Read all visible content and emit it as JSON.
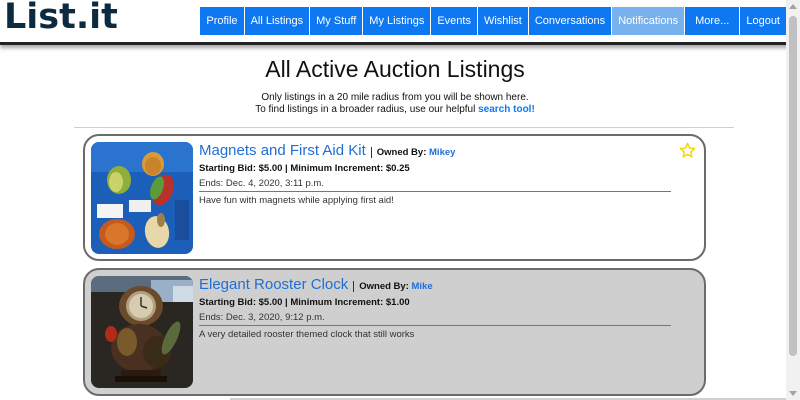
{
  "header": {
    "logo": "List.it",
    "nav": [
      {
        "label": "Profile"
      },
      {
        "label": "All Listings"
      },
      {
        "label": "My Stuff"
      },
      {
        "label": "My Listings"
      },
      {
        "label": "Events"
      },
      {
        "label": "Wishlist"
      },
      {
        "label": "Conversations"
      },
      {
        "label": "Notifications",
        "active": true
      },
      {
        "label": "More..."
      },
      {
        "label": "Logout"
      }
    ]
  },
  "page": {
    "title": "All Active Auction Listings",
    "intro_line1": "Only listings in a 20 mile radius from you will be shown here.",
    "intro_line2": "To find listings in a broader radius, use our helpful",
    "search_link": "search tool!"
  },
  "listings": [
    {
      "title": "Magnets and First Aid Kit",
      "owned_by_label": "Owned By:",
      "owner": "Mikey",
      "starting_bid": "Starting Bid: $5.00",
      "min_increment": "Minimum Increment: $0.25",
      "ends": "Ends: Dec. 4, 2020, 3:11 p.m.",
      "description": "Have fun with magnets while applying first aid!",
      "watch_icon": "star-icon"
    },
    {
      "title": "Elegant Rooster Clock",
      "owned_by_label": "Owned By:",
      "owner": "Mike",
      "starting_bid": "Starting Bid: $5.00",
      "min_increment": "Minimum Increment: $1.00",
      "ends": "Ends: Dec. 3, 2020, 9:12 p.m.",
      "description": "A very detailed rooster themed clock that still works"
    }
  ],
  "colors": {
    "nav_blue": "#0d78f2",
    "nav_active": "#77b2ef",
    "link_blue": "#1f6fd6",
    "logo": "#0d2b40",
    "star": "#f2d600"
  }
}
